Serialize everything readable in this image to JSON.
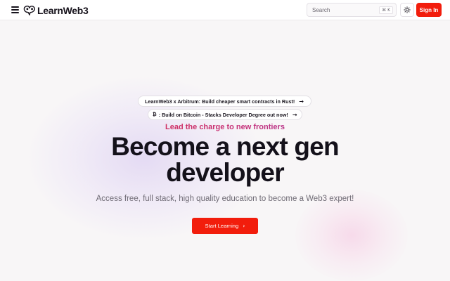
{
  "header": {
    "brand_name": "LearnWeb3",
    "search_placeholder": "Search",
    "search_shortcut": "⌘ K",
    "sign_in_label": "Sign In"
  },
  "announcements": [
    {
      "icon": "",
      "text": "LearnWeb3 x Arbitrum: Build cheaper smart contracts in Rust!"
    },
    {
      "icon": "₿",
      "text": ": Build on Bitcoin - Stacks Developer Degree out now!"
    }
  ],
  "hero": {
    "tagline": "Lead the charge to new frontiers",
    "title_line_1": "Become a next gen",
    "title_line_2": "developer",
    "subtitle": "Access free, full stack, high quality education to become a Web3 expert!",
    "cta_label": "Start Learning"
  },
  "icons": {
    "menu": "hamburger-menu-icon",
    "logo": "learnweb3-logo-icon",
    "theme": "sun-icon",
    "announcement_arrow": "arrow-right-icon",
    "cta_arrow": "chevron-right-icon"
  },
  "colors": {
    "accent": "#f21d0c",
    "text_primary": "#14111a",
    "text_muted": "#6f6b75",
    "background": "#f8f6f7",
    "tagline_gradient_start": "#e6292f",
    "tagline_gradient_end": "#8a45c8"
  }
}
